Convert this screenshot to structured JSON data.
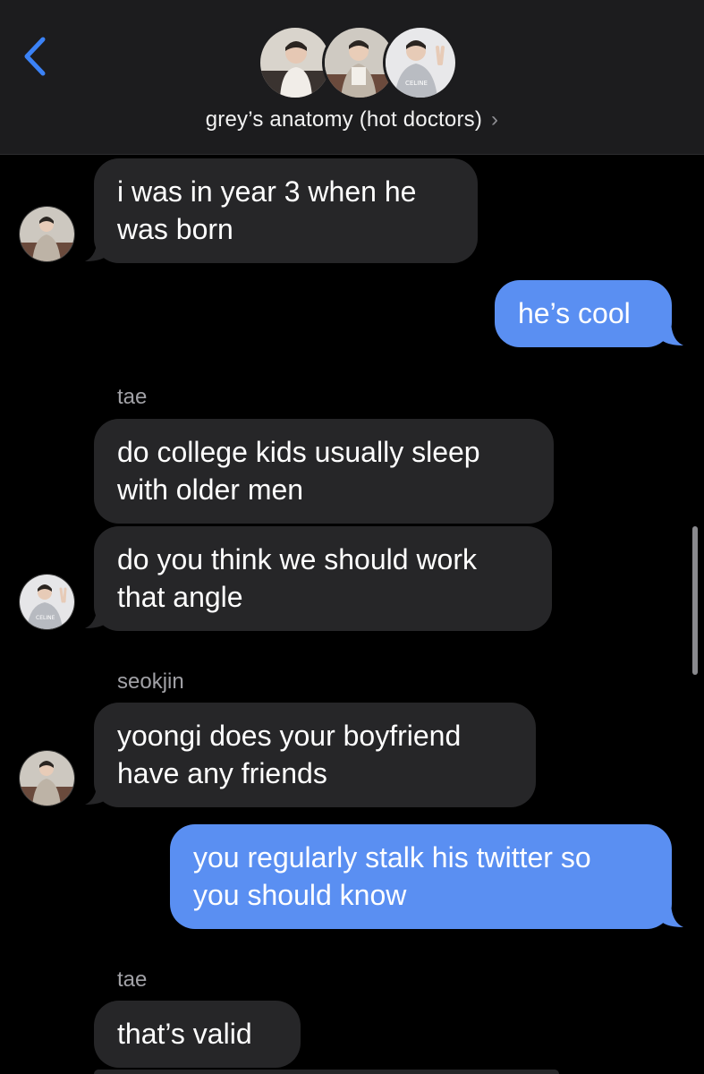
{
  "header": {
    "group_name": "grey’s anatomy (hot doctors)",
    "chevron": "›",
    "back_icon": "chevron-left-icon",
    "accent_color": "#3b82f6"
  },
  "messages": [
    {
      "id": "m1",
      "direction": "incoming",
      "sender": "",
      "text": "i was in year 3 when he\nwas born"
    },
    {
      "id": "m2",
      "direction": "outgoing",
      "sender": "",
      "text": "he’s cool"
    },
    {
      "id": "m3",
      "direction": "incoming",
      "sender": "tae",
      "text": "do college kids usually sleep\nwith older men"
    },
    {
      "id": "m4",
      "direction": "incoming",
      "sender": "",
      "text": "do you think we should work\nthat angle"
    },
    {
      "id": "m5",
      "direction": "incoming",
      "sender": "seokjin",
      "text": "yoongi does your boyfriend\nhave any friends"
    },
    {
      "id": "m6",
      "direction": "outgoing",
      "sender": "",
      "text": "you regularly stalk his twitter so\nyou should know"
    },
    {
      "id": "m7",
      "direction": "incoming",
      "sender": "tae",
      "text": "that’s valid"
    }
  ],
  "colors": {
    "incoming_bubble": "#262628",
    "outgoing_bubble": "#5a8ff2",
    "header_bg": "#1c1c1e"
  }
}
